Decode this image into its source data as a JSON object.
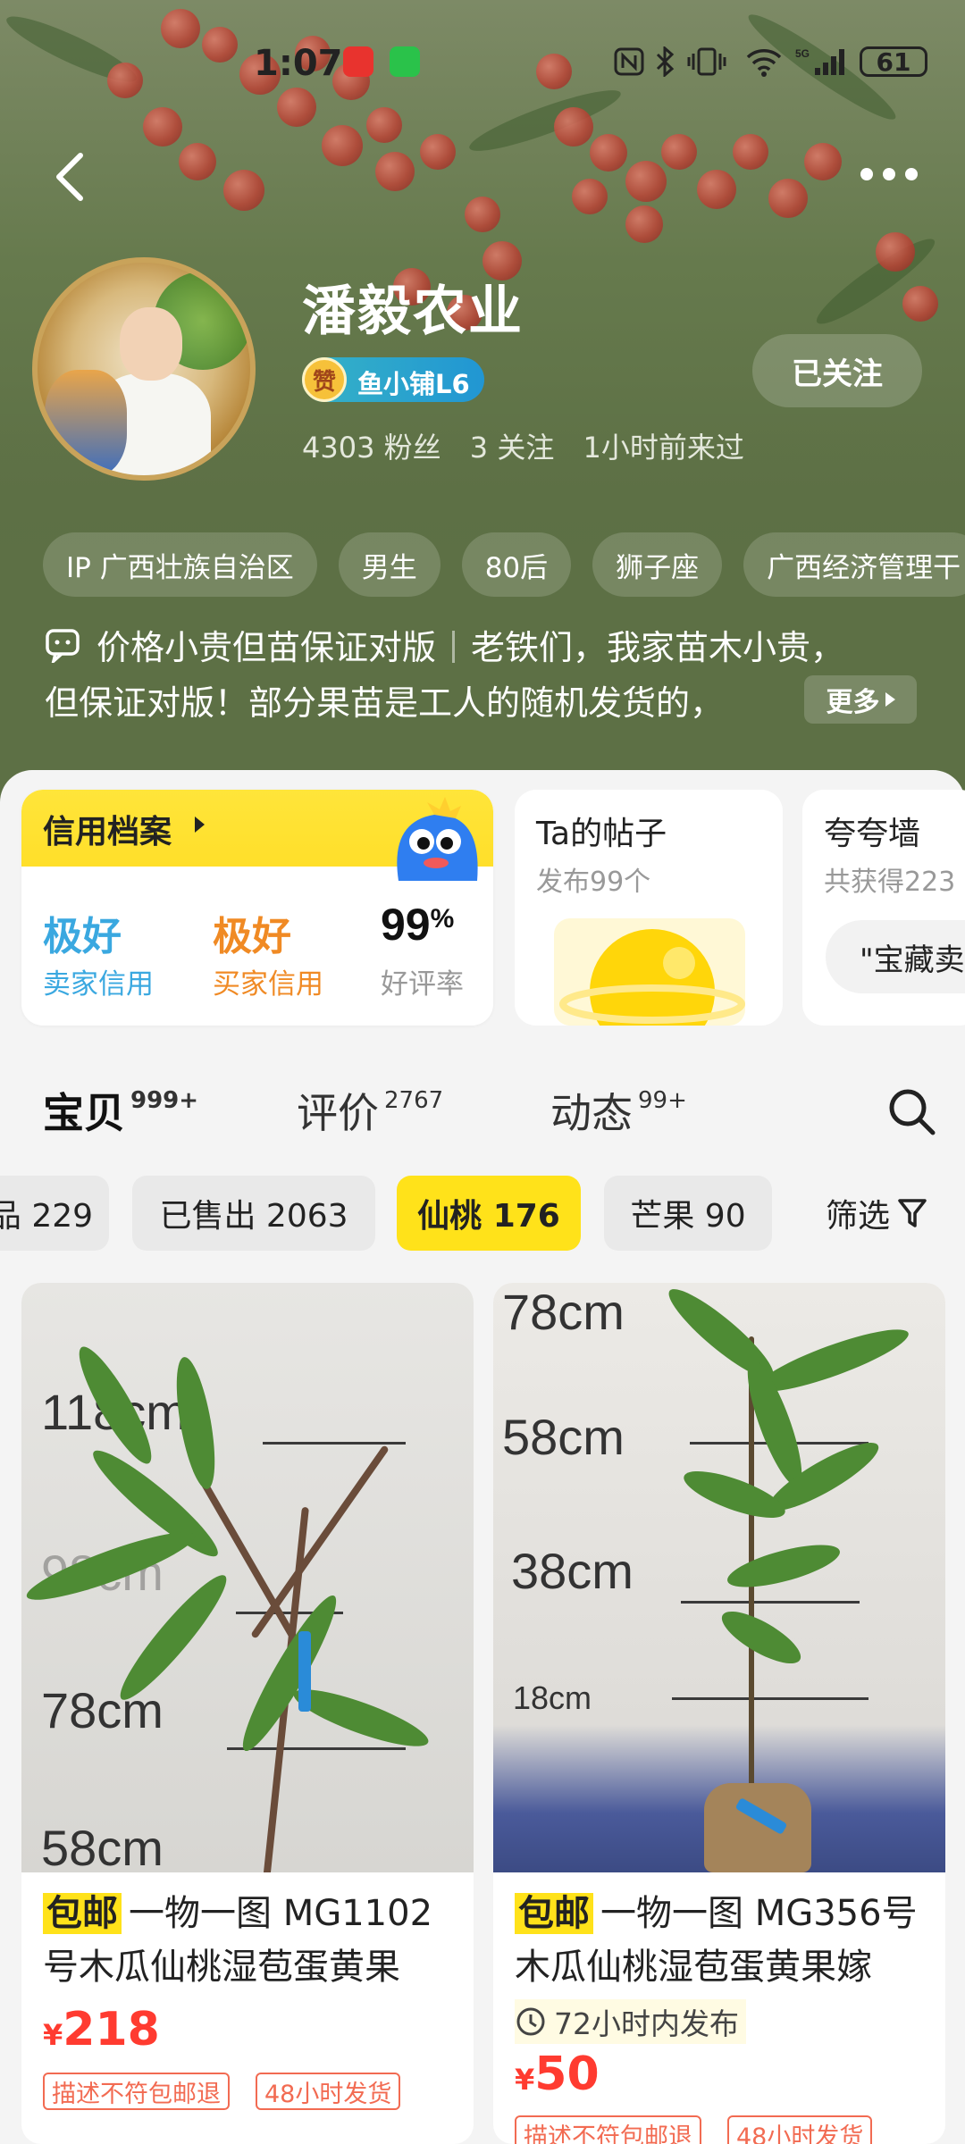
{
  "status_bar": {
    "time": "1:07",
    "notification_icons": [
      "huawei-app-icon",
      "wechat-icon"
    ],
    "system_icons": [
      "nfc-icon",
      "bluetooth-icon",
      "vibrate-icon",
      "wifi-icon",
      "5g-signal-icon"
    ],
    "battery": "61"
  },
  "header": {
    "shop_name": "潘毅农业",
    "badge_zan": "赞",
    "badge_label": "鱼小铺L6",
    "followers": "4303 粉丝",
    "following": "3 关注",
    "last_seen": "1小时前来过",
    "follow_button": "已关注",
    "tags": [
      "IP 广西壮族自治区",
      "男生",
      "80后",
      "狮子座",
      "广西经济管理干"
    ],
    "bio_line1_a": "价格小贵但苗保证对版",
    "bio_line1_b": "老铁们，我家苗木小贵，",
    "bio_line2": "但保证对版！部分果苗是工人的随机发货的，",
    "more_label": "更多"
  },
  "credit": {
    "title": "信用档案",
    "seller_value": "极好",
    "seller_label": "卖家信用",
    "buyer_value": "极好",
    "buyer_label": "买家信用",
    "rating_value": "99",
    "rating_unit": "%",
    "rating_label": "好评率"
  },
  "posts_card": {
    "title": "Ta的帖子",
    "subtitle": "发布99个"
  },
  "praise_card": {
    "title": "夸夸墙",
    "subtitle": "共获得223",
    "quote": "\"宝藏卖"
  },
  "tabs": [
    {
      "label": "宝贝",
      "count": "999+"
    },
    {
      "label": "评价",
      "count": "2767"
    },
    {
      "label": "动态",
      "count": "99+"
    }
  ],
  "chips": [
    "品 229",
    "已售出 2063",
    "仙桃 176",
    "芒果 90"
  ],
  "filter_label": "筛选",
  "products": [
    {
      "ship_tag": "包邮",
      "title": "一物一图 MG1102号木瓜仙桃湿苞蛋黄果",
      "price_symbol": "¥",
      "price": "218",
      "services": [
        "描述不符包邮退",
        "48小时发货"
      ],
      "ruler_labels": [
        "118cm",
        "98cm",
        "78cm",
        "58cm"
      ]
    },
    {
      "ship_tag": "包邮",
      "title": "一物一图 MG356号木瓜仙桃湿苞蛋黄果嫁",
      "recent": "72小时内发布",
      "price_symbol": "¥",
      "price": "50",
      "services": [
        "描述不符包邮退",
        "48小时发货"
      ],
      "ruler_labels": [
        "78cm",
        "58cm",
        "38cm",
        "18cm"
      ]
    }
  ],
  "colors": {
    "accent_yellow": "#ffe21a",
    "seller_credit": "#3aa8e0",
    "buyer_credit": "#f08a24",
    "price_red": "#ff3b30",
    "header_green": "#5d7045"
  }
}
